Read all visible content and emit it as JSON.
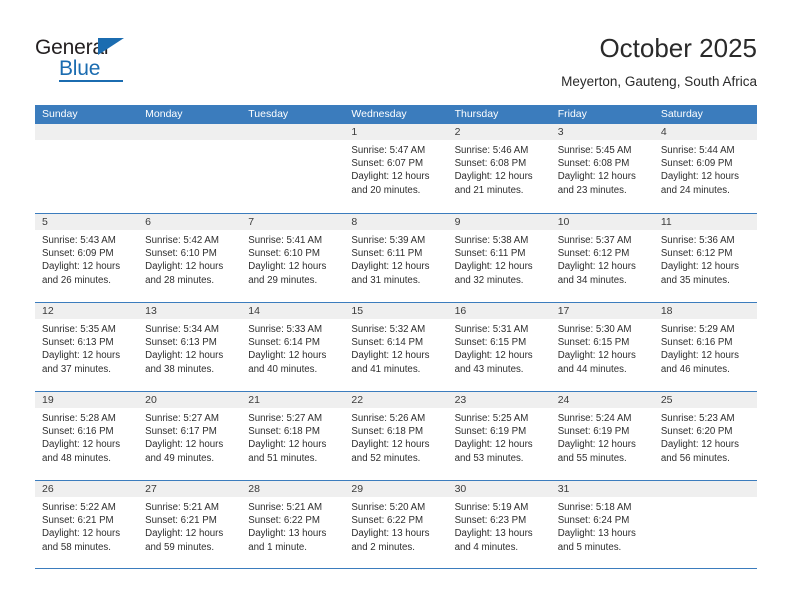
{
  "brand": {
    "name_top": "General",
    "name_bottom": "Blue",
    "accent_color": "#1b6cb0"
  },
  "header": {
    "title": "October 2025",
    "subtitle": "Meyerton, Gauteng, South Africa"
  },
  "theme": {
    "header_row_bg": "#3b7cbd",
    "day_band_bg": "#efefef",
    "grid_line": "#3b7cbd"
  },
  "weekdays": [
    "Sunday",
    "Monday",
    "Tuesday",
    "Wednesday",
    "Thursday",
    "Friday",
    "Saturday"
  ],
  "weeks": [
    [
      {
        "day": "",
        "lines": []
      },
      {
        "day": "",
        "lines": []
      },
      {
        "day": "",
        "lines": []
      },
      {
        "day": "1",
        "lines": [
          "Sunrise: 5:47 AM",
          "Sunset: 6:07 PM",
          "Daylight: 12 hours",
          "and 20 minutes."
        ]
      },
      {
        "day": "2",
        "lines": [
          "Sunrise: 5:46 AM",
          "Sunset: 6:08 PM",
          "Daylight: 12 hours",
          "and 21 minutes."
        ]
      },
      {
        "day": "3",
        "lines": [
          "Sunrise: 5:45 AM",
          "Sunset: 6:08 PM",
          "Daylight: 12 hours",
          "and 23 minutes."
        ]
      },
      {
        "day": "4",
        "lines": [
          "Sunrise: 5:44 AM",
          "Sunset: 6:09 PM",
          "Daylight: 12 hours",
          "and 24 minutes."
        ]
      }
    ],
    [
      {
        "day": "5",
        "lines": [
          "Sunrise: 5:43 AM",
          "Sunset: 6:09 PM",
          "Daylight: 12 hours",
          "and 26 minutes."
        ]
      },
      {
        "day": "6",
        "lines": [
          "Sunrise: 5:42 AM",
          "Sunset: 6:10 PM",
          "Daylight: 12 hours",
          "and 28 minutes."
        ]
      },
      {
        "day": "7",
        "lines": [
          "Sunrise: 5:41 AM",
          "Sunset: 6:10 PM",
          "Daylight: 12 hours",
          "and 29 minutes."
        ]
      },
      {
        "day": "8",
        "lines": [
          "Sunrise: 5:39 AM",
          "Sunset: 6:11 PM",
          "Daylight: 12 hours",
          "and 31 minutes."
        ]
      },
      {
        "day": "9",
        "lines": [
          "Sunrise: 5:38 AM",
          "Sunset: 6:11 PM",
          "Daylight: 12 hours",
          "and 32 minutes."
        ]
      },
      {
        "day": "10",
        "lines": [
          "Sunrise: 5:37 AM",
          "Sunset: 6:12 PM",
          "Daylight: 12 hours",
          "and 34 minutes."
        ]
      },
      {
        "day": "11",
        "lines": [
          "Sunrise: 5:36 AM",
          "Sunset: 6:12 PM",
          "Daylight: 12 hours",
          "and 35 minutes."
        ]
      }
    ],
    [
      {
        "day": "12",
        "lines": [
          "Sunrise: 5:35 AM",
          "Sunset: 6:13 PM",
          "Daylight: 12 hours",
          "and 37 minutes."
        ]
      },
      {
        "day": "13",
        "lines": [
          "Sunrise: 5:34 AM",
          "Sunset: 6:13 PM",
          "Daylight: 12 hours",
          "and 38 minutes."
        ]
      },
      {
        "day": "14",
        "lines": [
          "Sunrise: 5:33 AM",
          "Sunset: 6:14 PM",
          "Daylight: 12 hours",
          "and 40 minutes."
        ]
      },
      {
        "day": "15",
        "lines": [
          "Sunrise: 5:32 AM",
          "Sunset: 6:14 PM",
          "Daylight: 12 hours",
          "and 41 minutes."
        ]
      },
      {
        "day": "16",
        "lines": [
          "Sunrise: 5:31 AM",
          "Sunset: 6:15 PM",
          "Daylight: 12 hours",
          "and 43 minutes."
        ]
      },
      {
        "day": "17",
        "lines": [
          "Sunrise: 5:30 AM",
          "Sunset: 6:15 PM",
          "Daylight: 12 hours",
          "and 44 minutes."
        ]
      },
      {
        "day": "18",
        "lines": [
          "Sunrise: 5:29 AM",
          "Sunset: 6:16 PM",
          "Daylight: 12 hours",
          "and 46 minutes."
        ]
      }
    ],
    [
      {
        "day": "19",
        "lines": [
          "Sunrise: 5:28 AM",
          "Sunset: 6:16 PM",
          "Daylight: 12 hours",
          "and 48 minutes."
        ]
      },
      {
        "day": "20",
        "lines": [
          "Sunrise: 5:27 AM",
          "Sunset: 6:17 PM",
          "Daylight: 12 hours",
          "and 49 minutes."
        ]
      },
      {
        "day": "21",
        "lines": [
          "Sunrise: 5:27 AM",
          "Sunset: 6:18 PM",
          "Daylight: 12 hours",
          "and 51 minutes."
        ]
      },
      {
        "day": "22",
        "lines": [
          "Sunrise: 5:26 AM",
          "Sunset: 6:18 PM",
          "Daylight: 12 hours",
          "and 52 minutes."
        ]
      },
      {
        "day": "23",
        "lines": [
          "Sunrise: 5:25 AM",
          "Sunset: 6:19 PM",
          "Daylight: 12 hours",
          "and 53 minutes."
        ]
      },
      {
        "day": "24",
        "lines": [
          "Sunrise: 5:24 AM",
          "Sunset: 6:19 PM",
          "Daylight: 12 hours",
          "and 55 minutes."
        ]
      },
      {
        "day": "25",
        "lines": [
          "Sunrise: 5:23 AM",
          "Sunset: 6:20 PM",
          "Daylight: 12 hours",
          "and 56 minutes."
        ]
      }
    ],
    [
      {
        "day": "26",
        "lines": [
          "Sunrise: 5:22 AM",
          "Sunset: 6:21 PM",
          "Daylight: 12 hours",
          "and 58 minutes."
        ]
      },
      {
        "day": "27",
        "lines": [
          "Sunrise: 5:21 AM",
          "Sunset: 6:21 PM",
          "Daylight: 12 hours",
          "and 59 minutes."
        ]
      },
      {
        "day": "28",
        "lines": [
          "Sunrise: 5:21 AM",
          "Sunset: 6:22 PM",
          "Daylight: 13 hours",
          "and 1 minute."
        ]
      },
      {
        "day": "29",
        "lines": [
          "Sunrise: 5:20 AM",
          "Sunset: 6:22 PM",
          "Daylight: 13 hours",
          "and 2 minutes."
        ]
      },
      {
        "day": "30",
        "lines": [
          "Sunrise: 5:19 AM",
          "Sunset: 6:23 PM",
          "Daylight: 13 hours",
          "and 4 minutes."
        ]
      },
      {
        "day": "31",
        "lines": [
          "Sunrise: 5:18 AM",
          "Sunset: 6:24 PM",
          "Daylight: 13 hours",
          "and 5 minutes."
        ]
      },
      {
        "day": "",
        "lines": []
      }
    ]
  ]
}
